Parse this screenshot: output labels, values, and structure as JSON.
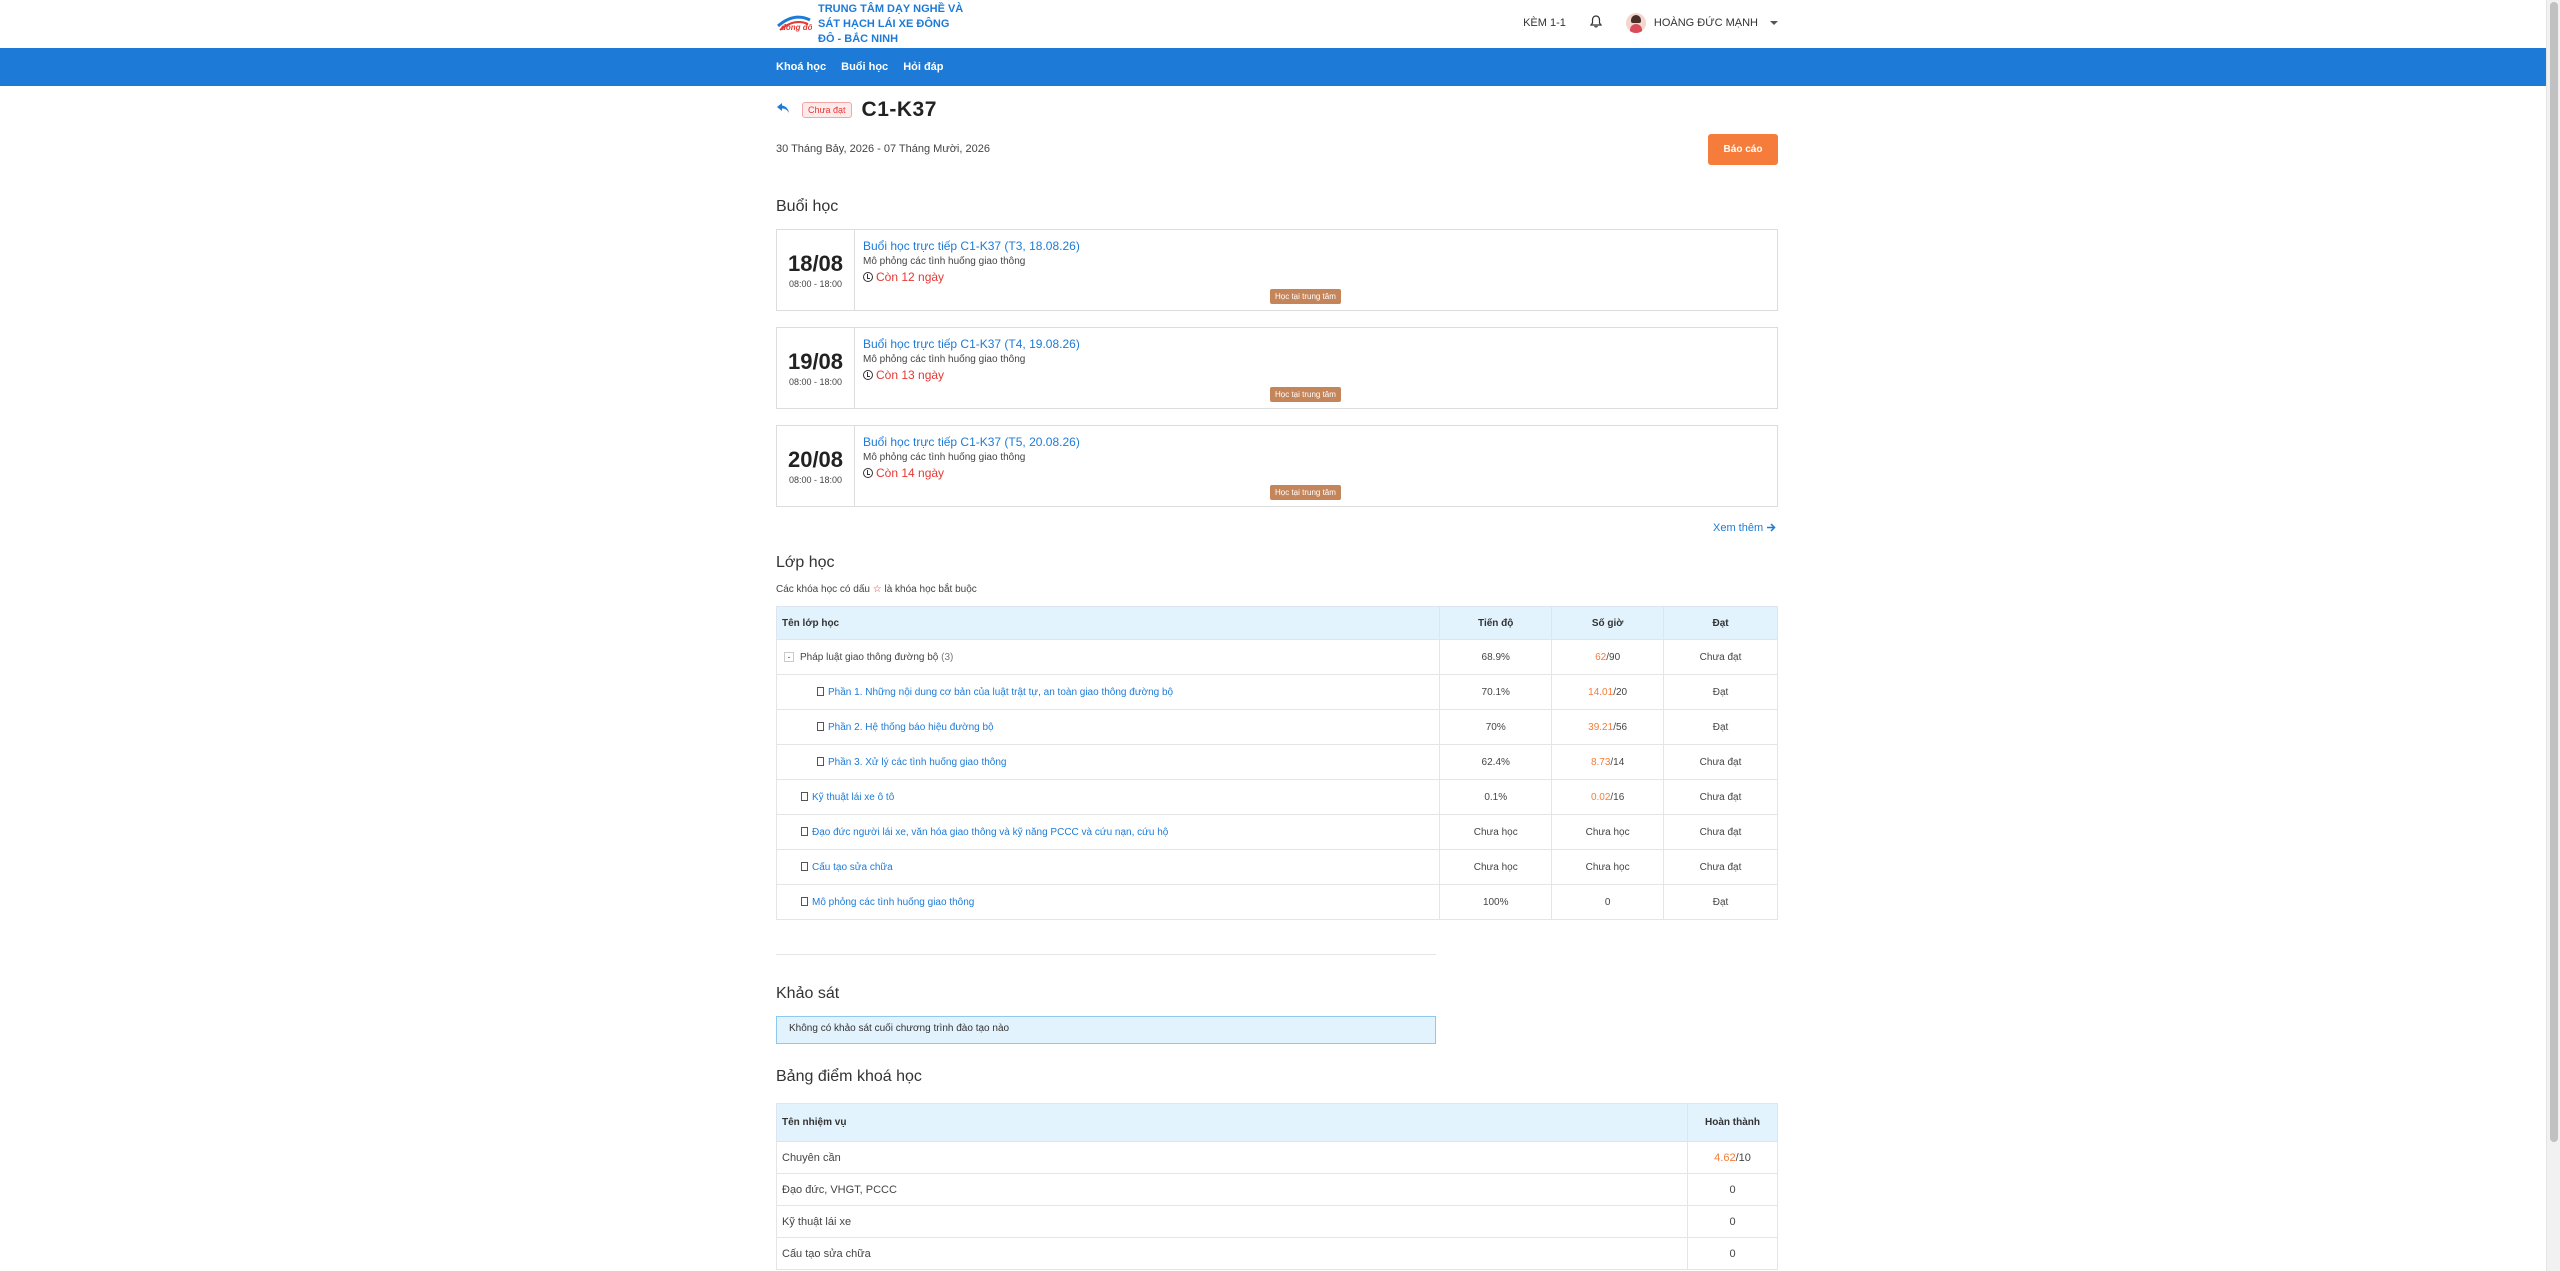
{
  "header": {
    "org_name": "TRUNG TÂM DẠY NGHỀ VÀ SÁT HẠCH LÁI XE ĐÔNG ĐÔ - BẮC NINH",
    "logo_text": "đông đô",
    "ke_label": "KÈM 1-1",
    "user_name": "HOÀNG ĐỨC MẠNH"
  },
  "nav": {
    "items": [
      {
        "label": "Khoá học"
      },
      {
        "label": "Buổi học"
      },
      {
        "label": "Hỏi đáp"
      }
    ]
  },
  "course": {
    "status_badge": "Chưa đạt",
    "title": "C1-K37",
    "date_range": "30 Tháng Bảy, 2026 - 07 Tháng Mười, 2026",
    "report_button": "Báo cáo"
  },
  "sessions": {
    "title": "Buổi học",
    "items": [
      {
        "day": "18/08",
        "time": "08:00 - 18:00",
        "name": "Buổi học trực tiếp C1-K37 (T3, 18.08.26)",
        "desc": "Mô phỏng các tình huống giao thông",
        "remain": "Còn 12 ngày",
        "tag": "Học tại trung tâm"
      },
      {
        "day": "19/08",
        "time": "08:00 - 18:00",
        "name": "Buổi học trực tiếp C1-K37 (T4, 19.08.26)",
        "desc": "Mô phỏng các tình huống giao thông",
        "remain": "Còn 13 ngày",
        "tag": "Học tại trung tâm"
      },
      {
        "day": "20/08",
        "time": "08:00 - 18:00",
        "name": "Buổi học trực tiếp C1-K37 (T5, 20.08.26)",
        "desc": "Mô phỏng các tình huống giao thông",
        "remain": "Còn 14 ngày",
        "tag": "Học tại trung tâm"
      }
    ],
    "see_more": "Xem thêm"
  },
  "classes": {
    "title": "Lớp học",
    "note_prefix": "Các khóa học có dấu",
    "note_star": "☆",
    "note_suffix": "là khóa học bắt buộc",
    "headers": {
      "name": "Tên lớp học",
      "progress": "Tiến độ",
      "hours": "Số giờ",
      "pass": "Đạt"
    },
    "rows": [
      {
        "name": "Pháp luật giao thông đường bộ",
        "count": "(3)",
        "progress": "68.9%",
        "hours_done": "62",
        "hours_total": "/90",
        "pass": "Chưa đạt"
      },
      {
        "name": "Phần 1. Những nội dung cơ bản của luật trật tự, an toàn giao thông đường bộ",
        "progress": "70.1%",
        "hours_done": "14.01",
        "hours_total": "/20",
        "pass": "Đạt"
      },
      {
        "name": "Phần 2. Hệ thống báo hiệu đường bộ",
        "progress": "70%",
        "hours_done": "39.21",
        "hours_total": "/56",
        "pass": "Đạt"
      },
      {
        "name": "Phần 3. Xử lý các tình huống giao thông",
        "progress": "62.4%",
        "hours_done": "8.73",
        "hours_total": "/14",
        "pass": "Chưa đạt"
      },
      {
        "name": "Kỹ thuật lái xe ô tô",
        "progress": "0.1%",
        "hours_done": "0.02",
        "hours_total": "/16",
        "pass": "Chưa đạt"
      },
      {
        "name": "Đạo đức người lái xe, văn hóa giao thông và kỹ năng PCCC và cứu nạn, cứu hộ",
        "progress": "Chưa học",
        "hours": "Chưa học",
        "pass": "Chưa đạt"
      },
      {
        "name": "Cấu tạo sửa chữa",
        "progress": "Chưa học",
        "hours": "Chưa học",
        "pass": "Chưa đạt"
      },
      {
        "name": "Mô phỏng các tình huống giao thông",
        "progress": "100%",
        "hours": "0",
        "pass": "Đạt"
      }
    ]
  },
  "survey": {
    "title": "Khảo sát",
    "message": "Không có khảo sát cuối chương trình đào tạo nào"
  },
  "scores": {
    "title": "Bảng điểm khoá học",
    "headers": {
      "task": "Tên nhiệm vụ",
      "done": "Hoàn thành"
    },
    "rows": [
      {
        "task": "Chuyên cần",
        "score": "4.62",
        "max": "/10"
      },
      {
        "task": "Đạo đức, VHGT, PCCC",
        "score": "0",
        "max": ""
      },
      {
        "task": "Kỹ thuật lái xe",
        "score": "0",
        "max": ""
      },
      {
        "task": "Cấu tạo sửa chữa",
        "score": "0",
        "max": ""
      }
    ]
  }
}
